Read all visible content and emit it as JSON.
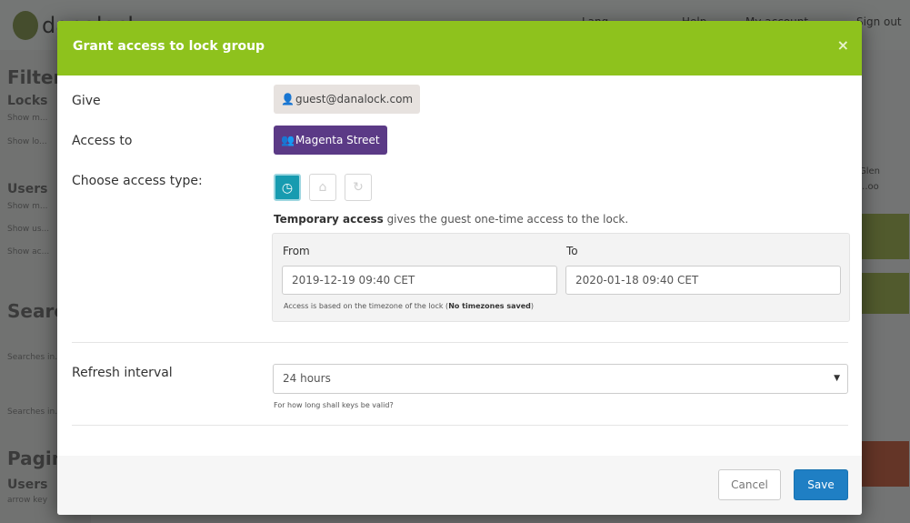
{
  "background": {
    "brand": "danalock",
    "nav": [
      "Lang...",
      "Help",
      "My account",
      "Sign out"
    ],
    "left": {
      "filter": "Filter",
      "locks": "Locks",
      "locks_items": [
        "Show m...",
        "Show lo..."
      ],
      "users": "Users",
      "users_items": [
        "Show m...",
        "Show us...",
        "Show ac..."
      ],
      "search": "Searc",
      "search_hint_1": "Searches in...",
      "search_hint_2": "Searches in...",
      "pagination": "Pagina",
      "pagination_users": "Users",
      "pagination_hint": "arrow key"
    },
    "right": {
      "text1": "Glen",
      "text2": "...oo"
    }
  },
  "modal": {
    "title": "Grant access to lock group",
    "close": "×",
    "give_label": "Give",
    "give_value": "guest@danalock.com",
    "access_label": "Access to",
    "access_value": "Magenta Street",
    "type_label": "Choose access type:",
    "type_buttons": [
      {
        "name": "temporary",
        "icon": "clock-icon",
        "glyph": "◷",
        "active": true
      },
      {
        "name": "permanent",
        "icon": "home-icon",
        "glyph": "⌂",
        "active": false
      },
      {
        "name": "recurring",
        "icon": "refresh-icon",
        "glyph": "↻",
        "active": false
      }
    ],
    "desc_bold": "Temporary access",
    "desc_rest": " gives the guest one-time access to the lock.",
    "from_label": "From",
    "to_label": "To",
    "from_value": "2019-12-19 09:40 CET",
    "to_value": "2020-01-18 09:40 CET",
    "tz_note": "Access is based on the timezone of the lock (",
    "tz_note_bold": "No timezones saved",
    "tz_note_end": ")",
    "refresh_label": "Refresh interval",
    "refresh_value": "24 hours",
    "refresh_help": "For how long shall keys be valid?",
    "cancel": "Cancel",
    "save": "Save"
  },
  "colors": {
    "header": "#8ec21d",
    "active_type": "#179bb0",
    "group_chip": "#5b3a86",
    "save": "#1f7fc4"
  }
}
